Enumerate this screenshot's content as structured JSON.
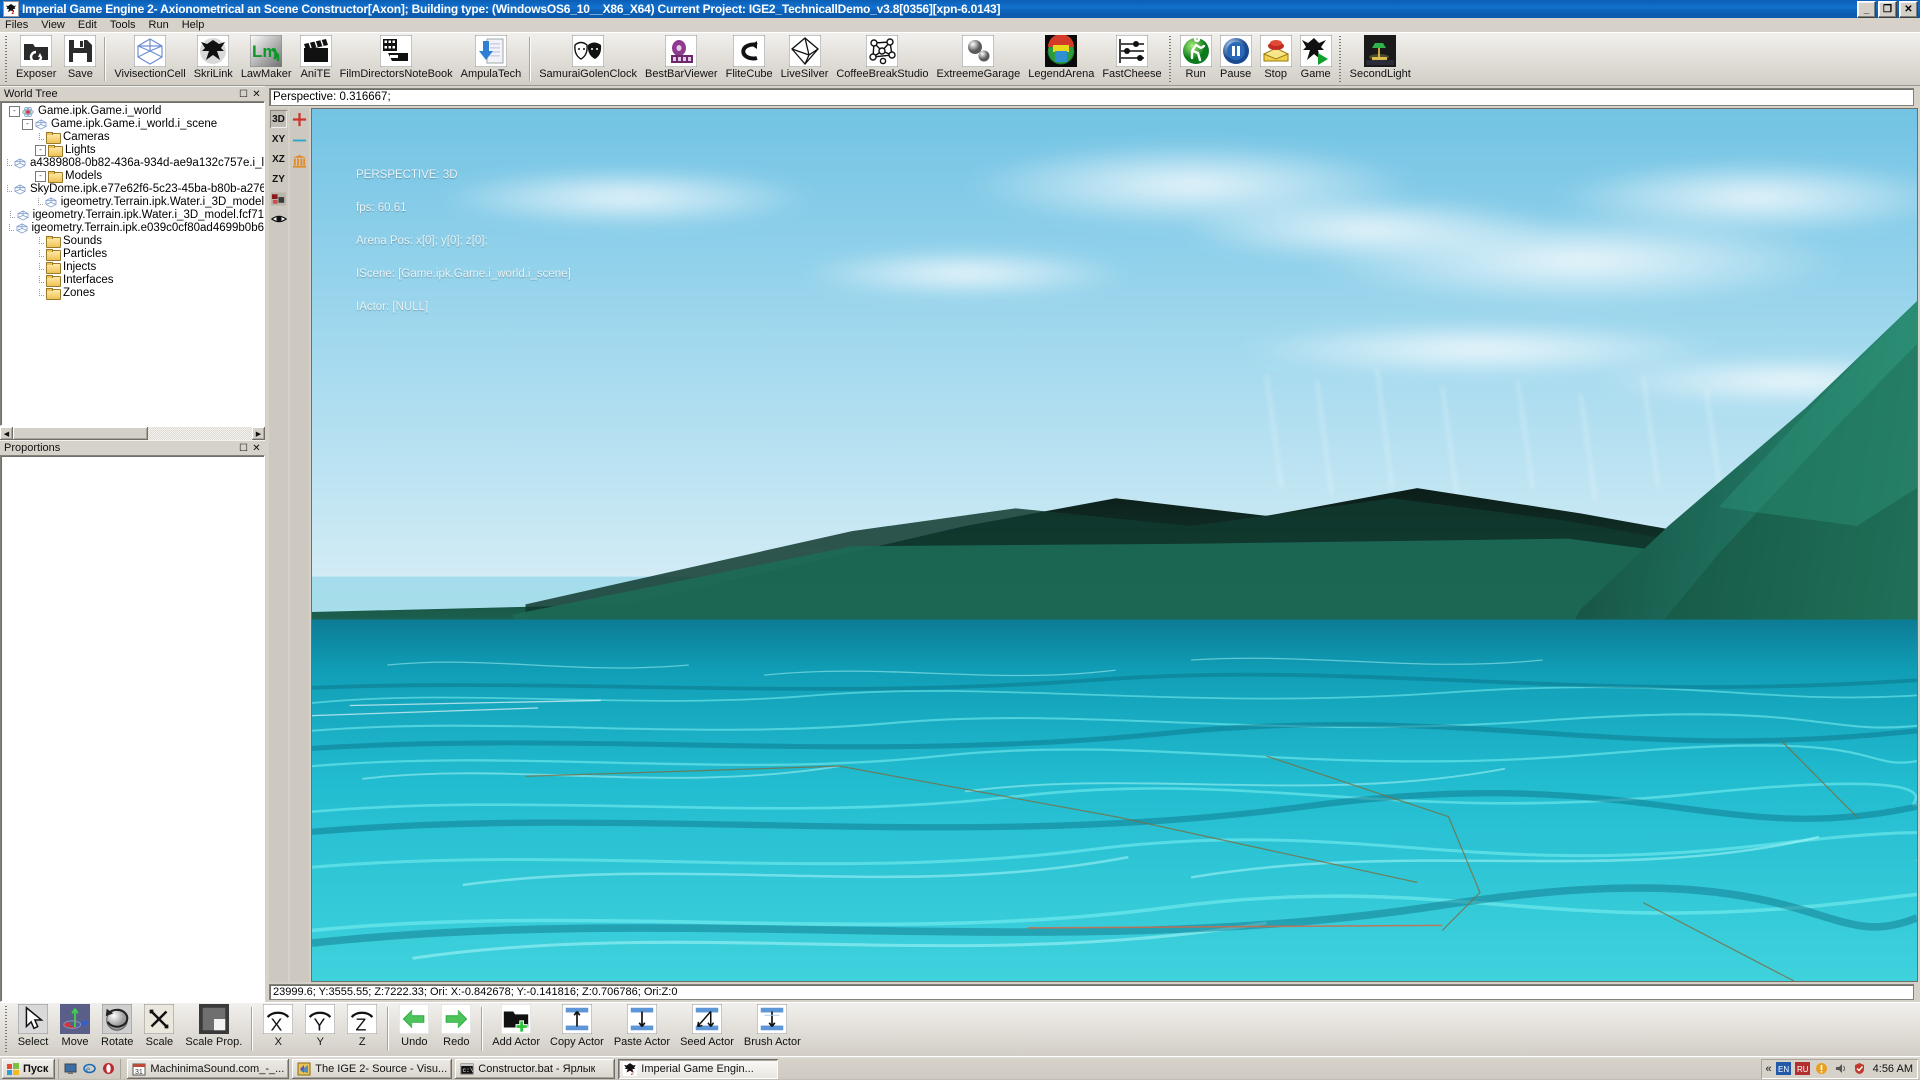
{
  "window": {
    "title": "Imperial Game Engine 2- Axionometrical an Scene Constructor[Axon]; Building type: (WindowsOS6_10__X86_X64) Current Project: IGE2_TechnicallDemo_v3.8[0356][xpn-6.0143]",
    "icon": "app-eagle-icon",
    "minimize": "_",
    "maximize": "❐",
    "close": "✕"
  },
  "menu": {
    "items": [
      "Files",
      "View",
      "Edit",
      "Tools",
      "Run",
      "Help"
    ]
  },
  "toolbar": {
    "groups": [
      {
        "items": [
          {
            "label": "Exposer",
            "icon": "open-folder-icon"
          },
          {
            "label": "Save",
            "icon": "floppy-disk-icon"
          }
        ]
      },
      {
        "items": [
          {
            "label": "VivisectionCell",
            "icon": "wireframe-cube-icon"
          },
          {
            "label": "SkriLink",
            "icon": "eagle-crest-icon"
          },
          {
            "label": "LawMaker",
            "icon": "lm-arrow-icon"
          },
          {
            "label": "AniTE",
            "icon": "clapperboard-icon"
          },
          {
            "label": "FilmDirectorsNoteBook",
            "icon": "film-strip-icon"
          },
          {
            "label": "AmpulaTech",
            "icon": "blue-down-arrow-doc-icon"
          }
        ]
      },
      {
        "items": [
          {
            "label": "SamuraiGolenClock",
            "icon": "theatre-masks-icon"
          },
          {
            "label": "BestBarViewer",
            "icon": "purple-film-reel-icon"
          },
          {
            "label": "FliteCube",
            "icon": "loop-arrow-icon"
          },
          {
            "label": "LiveSilver",
            "icon": "octahedron-icon"
          },
          {
            "label": "CoffeeBreakStudio",
            "icon": "node-graph-icon"
          },
          {
            "label": "ExtreemeGarage",
            "icon": "two-spheres-icon"
          },
          {
            "label": "LegendArena",
            "icon": "colored-sphere-icon"
          },
          {
            "label": "FastCheese",
            "icon": "sliders-icon"
          }
        ]
      },
      {
        "items": [
          {
            "label": "Run",
            "icon": "green-run-icon"
          },
          {
            "label": "Pause",
            "icon": "blue-pause-icon"
          },
          {
            "label": "Stop",
            "icon": "red-stop-icon"
          },
          {
            "label": "Game",
            "icon": "eagle-play-icon"
          }
        ]
      },
      {
        "items": [
          {
            "label": "SecondLight",
            "icon": "desk-lamp-icon"
          }
        ]
      }
    ]
  },
  "world_tree": {
    "title": "World Tree",
    "nodes": [
      {
        "label": "Game.ipk.Game.i_world",
        "depth": 0,
        "icon": "atom-icon",
        "toggle": "-"
      },
      {
        "label": "Game.ipk.Game.i_world.i_scene",
        "depth": 1,
        "icon": "cube-icon",
        "toggle": "-"
      },
      {
        "label": "Cameras",
        "depth": 2,
        "icon": "folder-icon",
        "toggle": ""
      },
      {
        "label": "Lights",
        "depth": 2,
        "icon": "folder-icon",
        "toggle": "-"
      },
      {
        "label": "a4389808-0b82-436a-934d-ae9a132c757e.i_l",
        "depth": 3,
        "icon": "cube-icon",
        "toggle": ""
      },
      {
        "label": "Models",
        "depth": 2,
        "icon": "folder-icon",
        "toggle": "-"
      },
      {
        "label": "SkyDome.ipk.e77e62f6-5c23-45ba-b80b-a276",
        "depth": 3,
        "icon": "cube-icon",
        "toggle": ""
      },
      {
        "label": "igeometry.Terrain.ipk.Water.i_3D_model",
        "depth": 3,
        "icon": "cube-icon",
        "toggle": ""
      },
      {
        "label": "igeometry.Terrain.ipk.Water.i_3D_model.fcf71",
        "depth": 3,
        "icon": "cube-icon",
        "toggle": ""
      },
      {
        "label": "igeometry.Terrain.ipk.e039c0cf80ad4699b0b6",
        "depth": 3,
        "icon": "cube-icon",
        "toggle": ""
      },
      {
        "label": "Sounds",
        "depth": 2,
        "icon": "folder-icon",
        "toggle": ""
      },
      {
        "label": "Particles",
        "depth": 2,
        "icon": "folder-icon",
        "toggle": ""
      },
      {
        "label": "Injects",
        "depth": 2,
        "icon": "folder-icon",
        "toggle": ""
      },
      {
        "label": "Interfaces",
        "depth": 2,
        "icon": "folder-icon",
        "toggle": ""
      },
      {
        "label": "Zones",
        "depth": 2,
        "icon": "folder-icon",
        "toggle": ""
      }
    ]
  },
  "proportions": {
    "title": "Proportions"
  },
  "viewport": {
    "perspective_field": "Perspective: 0.316667;",
    "status_field": "23999.6; Y:3555.55; Z:7222.33; Ori: X:-0.842678; Y:-0.141816; Z:0.706786; Ori:Z:0",
    "view_buttons": [
      {
        "label": "3D",
        "name": "view-mode-3d"
      },
      {
        "label": "XY",
        "name": "view-mode-xy"
      },
      {
        "label": "XZ",
        "name": "view-mode-xz"
      },
      {
        "label": "ZY",
        "name": "view-mode-zy"
      },
      {
        "label": "",
        "name": "texture-view-icon"
      },
      {
        "label": "",
        "name": "eye-visibility-icon"
      }
    ],
    "tool_buttons": [
      {
        "name": "red-crosshair-icon"
      },
      {
        "name": "blue-line-icon"
      },
      {
        "name": "temple-grid-icon"
      }
    ],
    "overlay": {
      "perspective": "PERSPECTIVE: 3D",
      "fps": "fps: 60.61",
      "arena_pos": "Arena Pos: x[0]; y[0]; z[0];",
      "iscene": "IScene: [Game.ipk.Game.i_world.i_scene]",
      "iactor": "IActor: [NULL]"
    }
  },
  "bottom_toolbar": {
    "groups": [
      {
        "items": [
          {
            "label": "Select",
            "icon": "cursor-arrow-icon",
            "pressed": true
          },
          {
            "label": "Move",
            "icon": "move-gizmo-icon"
          },
          {
            "label": "Rotate",
            "icon": "rotate-sphere-icon"
          },
          {
            "label": "Scale",
            "icon": "scale-icon"
          },
          {
            "label": "Scale Prop.",
            "icon": "scale-proportional-icon"
          }
        ]
      },
      {
        "items": [
          {
            "label": "X",
            "icon": "axis-x-icon"
          },
          {
            "label": "Y",
            "icon": "axis-y-icon"
          },
          {
            "label": "Z",
            "icon": "axis-z-icon"
          }
        ]
      },
      {
        "items": [
          {
            "label": "Undo",
            "icon": "undo-arrow-icon"
          },
          {
            "label": "Redo",
            "icon": "redo-arrow-icon"
          }
        ]
      },
      {
        "items": [
          {
            "label": "Add Actor",
            "icon": "add-actor-icon"
          },
          {
            "label": "Copy Actor",
            "icon": "copy-actor-icon"
          },
          {
            "label": "Paste Actor",
            "icon": "paste-actor-icon"
          },
          {
            "label": "Seed Actor",
            "icon": "seed-actor-icon"
          },
          {
            "label": "Brush Actor",
            "icon": "brush-actor-icon"
          }
        ]
      }
    ]
  },
  "taskbar": {
    "start": "Пуск",
    "quick_launch": [
      "show-desktop-icon",
      "internet-explorer-icon",
      "opera-icon"
    ],
    "tasks": [
      {
        "label": "MachinimaSound.com_-_...",
        "icon": "calendar-icon",
        "active": false
      },
      {
        "label": "The IGE 2- Source - Visu...",
        "icon": "visual-studio-icon",
        "active": false
      },
      {
        "label": "Constructor.bat - Ярлык",
        "icon": "console-icon",
        "active": false
      },
      {
        "label": "Imperial Game Engin...",
        "icon": "app-eagle-icon",
        "active": true
      }
    ],
    "tray": {
      "chevron": "«",
      "icons": [
        "language-icon",
        "lang2-icon",
        "warning-icon",
        "volume-icon",
        "shield-icon"
      ],
      "clock": "4:56 AM"
    }
  },
  "colors": {
    "title_blue": "#0e63ba",
    "face": "#d6d2ca",
    "sky": "#8ecfe8",
    "water": "#1fb4c8",
    "terrain": "#1d6b5c"
  }
}
